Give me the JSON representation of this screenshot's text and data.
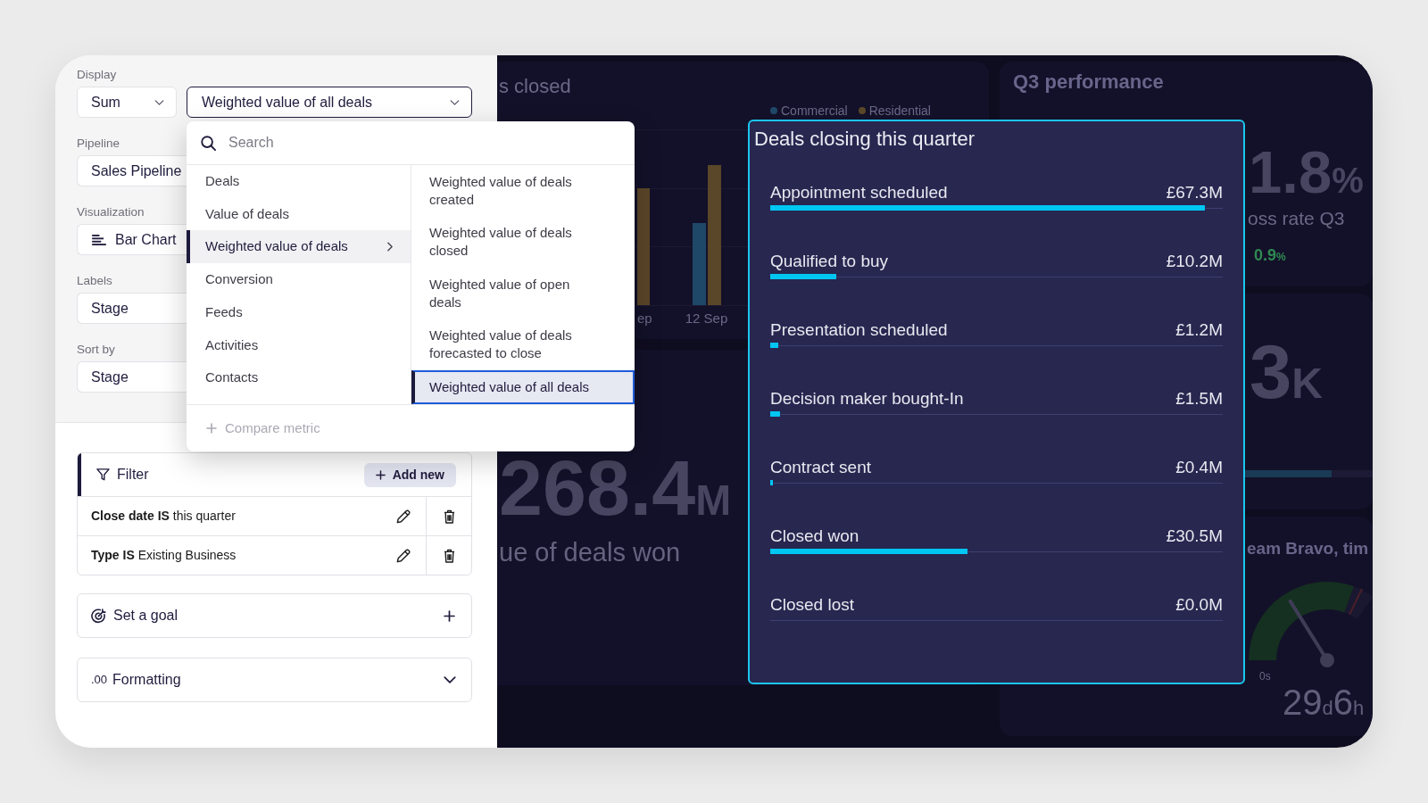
{
  "settings": {
    "display_label": "Display",
    "aggregate": {
      "value": "Sum"
    },
    "metric": {
      "value": "Weighted value of all deals",
      "expanded": true
    },
    "fields": [
      {
        "label": "Pipeline",
        "value": "Sales Pipeline",
        "kind": "text"
      },
      {
        "label": "Visualization",
        "value": "Bar Chart",
        "kind": "chart"
      },
      {
        "label": "Labels",
        "value": "Stage",
        "kind": "text"
      },
      {
        "label": "Sort by",
        "value": "Stage",
        "kind": "text"
      }
    ]
  },
  "metric_menu": {
    "search": {
      "placeholder": "Search"
    },
    "categories": [
      {
        "label": "Deals",
        "selected": false
      },
      {
        "label": "Value of deals",
        "selected": false
      },
      {
        "label": "Weighted value of deals",
        "selected": true
      },
      {
        "label": "Conversion",
        "selected": false
      },
      {
        "label": "Feeds",
        "selected": false
      },
      {
        "label": "Activities",
        "selected": false
      },
      {
        "label": "Contacts",
        "selected": false
      }
    ],
    "metrics": [
      {
        "label": "Weighted value of deals created",
        "selected": false
      },
      {
        "label": "Weighted value of deals closed",
        "selected": false
      },
      {
        "label": "Weighted value of open deals",
        "selected": false
      },
      {
        "label": "Weighted value of deals forecasted to close",
        "selected": false
      },
      {
        "label": "Weighted value of all deals",
        "selected": true
      }
    ],
    "compare": {
      "label": "Compare metric",
      "disabled": true
    }
  },
  "filter": {
    "title": "Filter",
    "add_label": "Add new",
    "rules": [
      {
        "text": "**Close date IS** this quarter"
      },
      {
        "text": "**Type IS** Existing Business"
      }
    ]
  },
  "goal": {
    "label": "Set a goal"
  },
  "formatting": {
    "symbol": ".00",
    "label": "Formatting"
  },
  "dashboard": {
    "closed_chart": {
      "title": "s closed",
      "legend": [
        {
          "label": "Commercial",
          "color": "#1f4868"
        },
        {
          "label": "Residential",
          "color": "#5a4628"
        }
      ],
      "axis_labels": [
        "ep",
        "12 Sep"
      ]
    },
    "won_tile": {
      "value": "268.4",
      "unit": "M",
      "caption": "ue of deals won"
    },
    "q3_tile": {
      "title": "Q3 performance",
      "value": "1.8",
      "unit": "%",
      "caption": "oss rate Q3",
      "change": "0.9",
      "change_unit": "%"
    },
    "count_tile": {
      "value": "3",
      "unit": "K",
      "level": 0.68
    },
    "time_tile": {
      "title": "eam Bravo, tim",
      "gauge_label": "0s",
      "duration": [
        {
          "text": "29",
          "kind": "number"
        },
        {
          "text": "d",
          "kind": "unit"
        },
        {
          "text": "6",
          "kind": "number"
        },
        {
          "text": "h",
          "kind": "unit"
        }
      ]
    }
  },
  "deals_card": {
    "title": "Deals closing this quarter",
    "stages": [
      {
        "name": "Appointment scheduled",
        "value": "£67.3M",
        "level": 0.961
      },
      {
        "name": "Qualified to buy",
        "value": "£10.2M",
        "level": 0.146
      },
      {
        "name": "Presentation scheduled",
        "value": "£1.2M",
        "level": 0.017
      },
      {
        "name": "Decision maker bought-In",
        "value": "£1.5M",
        "level": 0.021
      },
      {
        "name": "Contract sent",
        "value": "£0.4M",
        "level": 0.006
      },
      {
        "name": "Closed won",
        "value": "£30.5M",
        "level": 0.436
      },
      {
        "name": "Closed lost",
        "value": "£0.0M"
      }
    ]
  }
}
